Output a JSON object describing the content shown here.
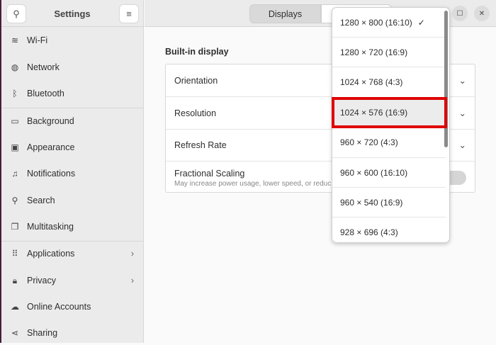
{
  "sidebar": {
    "title": "Settings",
    "items": [
      {
        "label": "Wi-Fi",
        "icon": "wifi-icon",
        "glyph": "≋"
      },
      {
        "label": "Network",
        "icon": "network-icon",
        "glyph": "◍"
      },
      {
        "label": "Bluetooth",
        "icon": "bluetooth-icon",
        "glyph": "ᛒ"
      },
      {
        "label": "Background",
        "icon": "background-icon",
        "glyph": "▭"
      },
      {
        "label": "Appearance",
        "icon": "appearance-icon",
        "glyph": "▣"
      },
      {
        "label": "Notifications",
        "icon": "bell-icon",
        "glyph": "♫"
      },
      {
        "label": "Search",
        "icon": "search-icon",
        "glyph": "⚲"
      },
      {
        "label": "Multitasking",
        "icon": "multitasking-icon",
        "glyph": "❐"
      },
      {
        "label": "Applications",
        "icon": "applications-icon",
        "glyph": "⠿"
      },
      {
        "label": "Privacy",
        "icon": "lock-icon",
        "glyph": "🔒︎"
      },
      {
        "label": "Online Accounts",
        "icon": "cloud-icon",
        "glyph": "☁"
      },
      {
        "label": "Sharing",
        "icon": "share-icon",
        "glyph": "⋖"
      }
    ]
  },
  "header": {
    "tabs": [
      "Displays",
      ""
    ]
  },
  "main": {
    "section": "Built-in display",
    "rows": [
      "Orientation",
      "Resolution",
      "Refresh Rate"
    ],
    "fractional": {
      "label": "Fractional Scaling",
      "description": "May increase power usage, lower speed, or reduc"
    }
  },
  "popup": {
    "options": [
      "1280 × 800 (16:10)",
      "1280 × 720 (16:9)",
      "1024 × 768 (4:3)",
      "1024 × 576 (16:9)",
      "960 × 720 (4:3)",
      "960 × 600 (16:10)",
      "960 × 540 (16:9)",
      "928 × 696 (4:3)"
    ],
    "checked": "✓"
  }
}
